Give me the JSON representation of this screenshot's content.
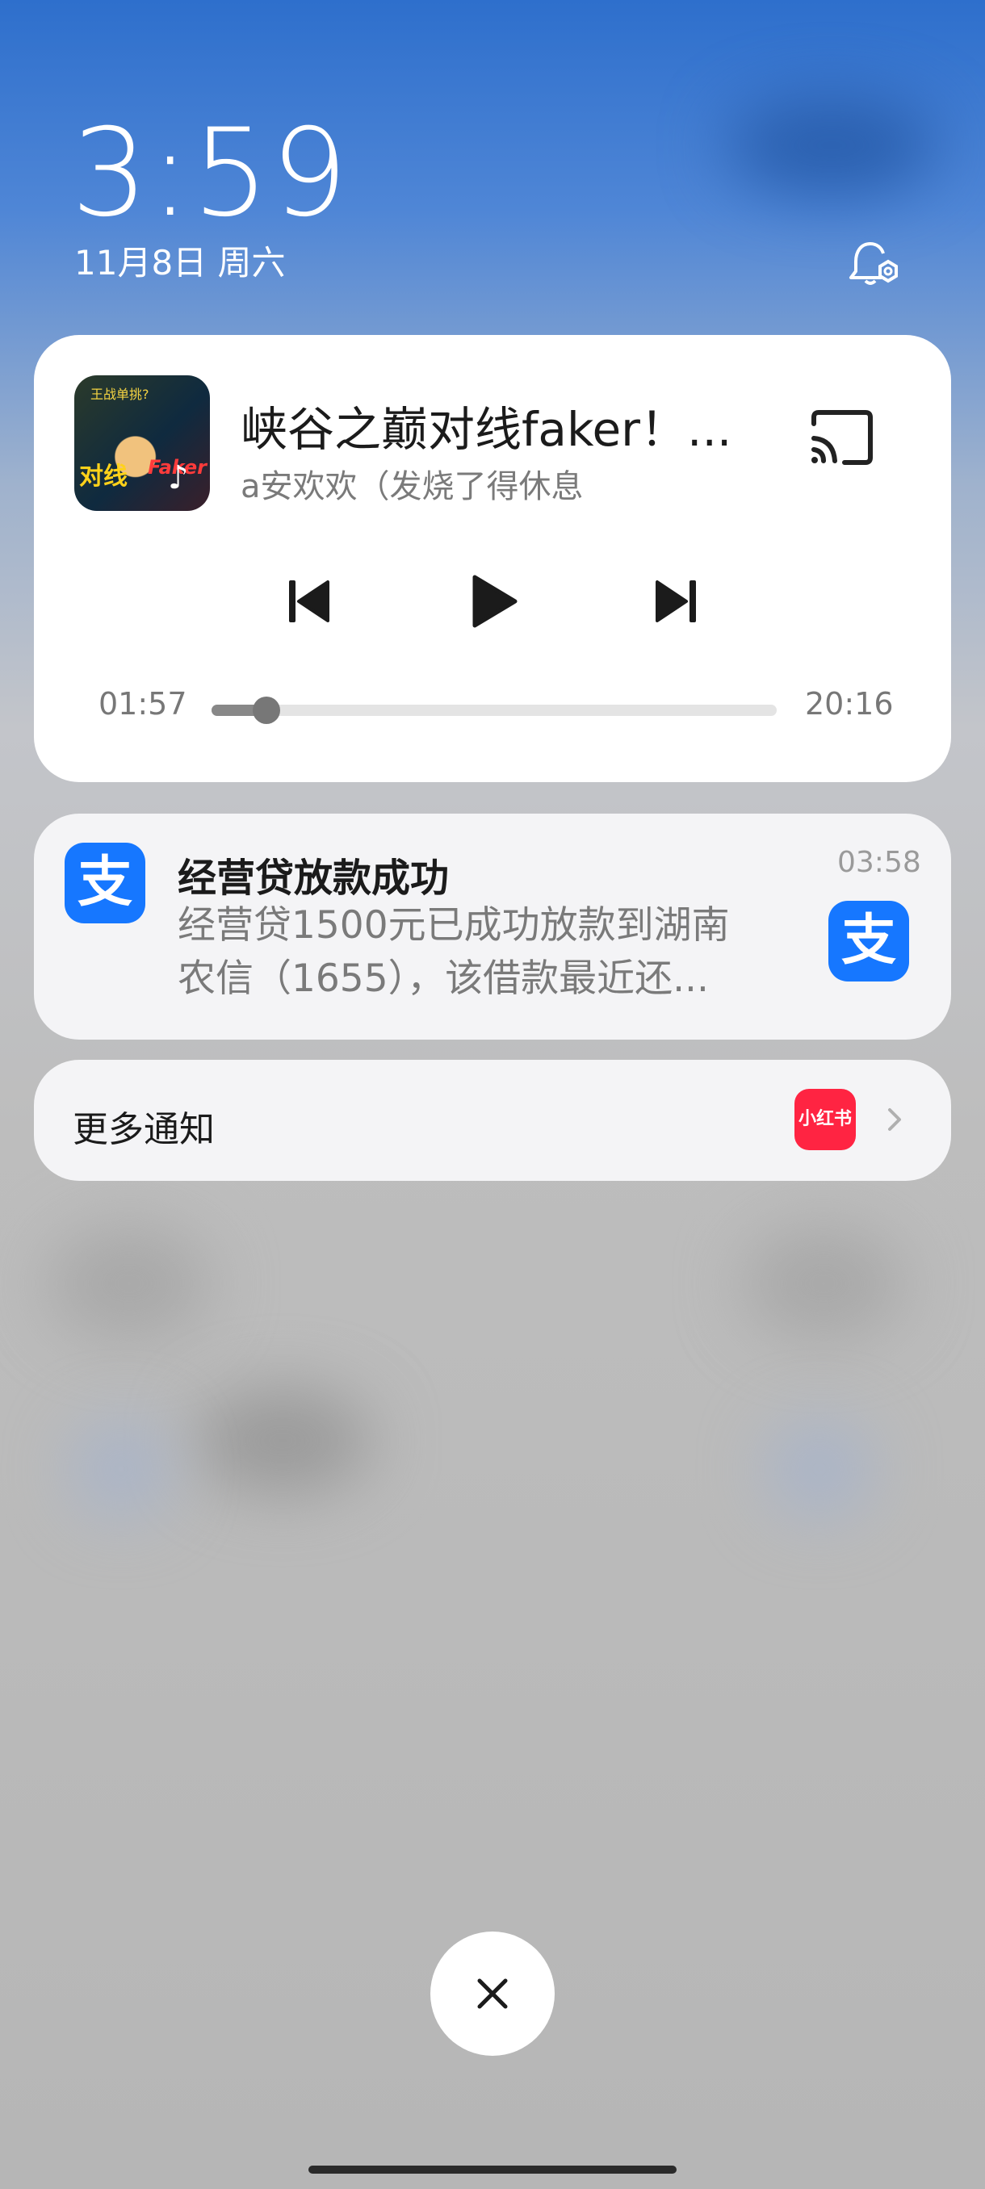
{
  "lockscreen": {
    "time": "3:59",
    "date": "11月8日 周六"
  },
  "media": {
    "album_art": {
      "text_top": "王战单挑?",
      "text_left": "对线",
      "text_right": "Faker"
    },
    "title": "峡谷之巅对线faker！...",
    "subtitle": "a安欢欢（发烧了得休息",
    "time_current": "01:57",
    "time_total": "20:16",
    "progress": 0.097,
    "icons": [
      "cast-icon",
      "previous-icon",
      "play-icon",
      "next-icon"
    ]
  },
  "notification": {
    "app_icon_text": "支",
    "title": "经营贷放款成功",
    "time": "03:58",
    "body_line1": "经营贷1500元已成功放款到湖南",
    "body_line2": "农信（1655），该借款最近还...",
    "accent": "#1677ff"
  },
  "more_notifications": {
    "label": "更多通知",
    "app_icon_text": "小红书",
    "app_color": "#ff2442"
  },
  "close_icon": "close-icon"
}
